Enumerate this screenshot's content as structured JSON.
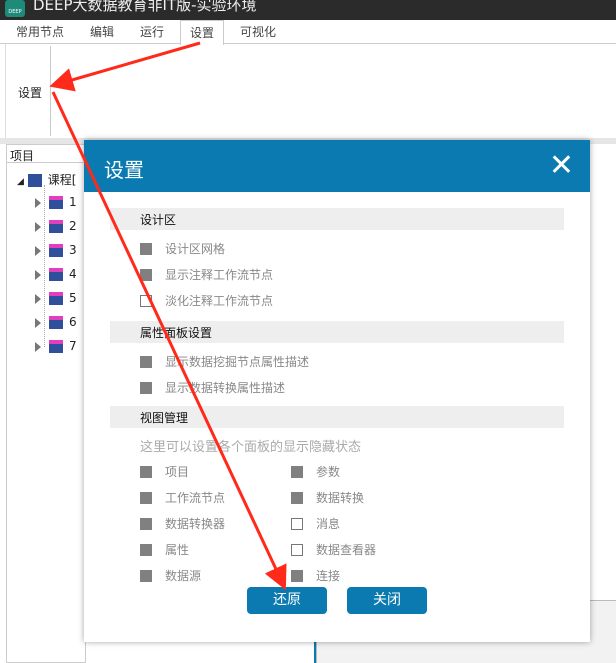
{
  "app": {
    "logo_text": "DEEP",
    "title": "DEEP大数据教育非IT版-实验环境"
  },
  "tabs": [
    "常用节点",
    "编辑",
    "运行",
    "设置",
    "可视化"
  ],
  "ribbon": {
    "settings_button": "设置"
  },
  "project_panel": {
    "header": "项目",
    "root": "课程[",
    "items": [
      "1",
      "2",
      "3",
      "4",
      "5",
      "6",
      "7"
    ]
  },
  "dialog": {
    "title": "设置",
    "sections": {
      "design": {
        "title": "设计区",
        "options": [
          {
            "label": "设计区网格",
            "checked": true
          },
          {
            "label": "显示注释工作流节点",
            "checked": true
          },
          {
            "label": "淡化注释工作流节点",
            "checked": false
          }
        ]
      },
      "property": {
        "title": "属性面板设置",
        "options": [
          {
            "label": "显示数据挖掘节点属性描述",
            "checked": true
          },
          {
            "label": "显示数据转换属性描述",
            "checked": true
          }
        ]
      },
      "view": {
        "title": "视图管理",
        "hint": "这里可以设置各个面板的显示隐藏状态",
        "left": [
          {
            "label": "项目",
            "checked": true
          },
          {
            "label": "工作流节点",
            "checked": true
          },
          {
            "label": "数据转换器",
            "checked": true
          },
          {
            "label": "属性",
            "checked": true
          },
          {
            "label": "数据源",
            "checked": true
          }
        ],
        "right": [
          {
            "label": "参数",
            "checked": true
          },
          {
            "label": "数据转换",
            "checked": true
          },
          {
            "label": "消息",
            "checked": false
          },
          {
            "label": "数据查看器",
            "checked": false
          },
          {
            "label": "连接",
            "checked": true
          }
        ]
      }
    },
    "restore_button": "还原",
    "close_button": "关闭"
  },
  "colors": {
    "accent": "#0a7ab0",
    "annotation": "#ff2a1a"
  }
}
